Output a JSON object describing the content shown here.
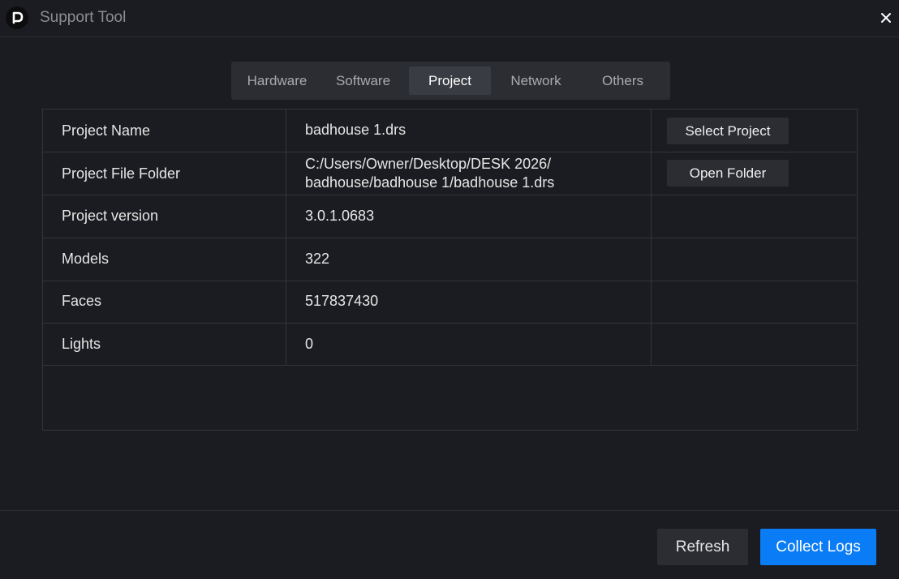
{
  "window": {
    "title": "Support Tool",
    "logo_icon": "app-logo-icon",
    "close_icon": "close-icon"
  },
  "tabs": [
    {
      "label": "Hardware",
      "active": false
    },
    {
      "label": "Software",
      "active": false
    },
    {
      "label": "Project",
      "active": true
    },
    {
      "label": "Network",
      "active": false
    },
    {
      "label": "Others",
      "active": false
    }
  ],
  "project": {
    "rows": [
      {
        "label": "Project Name",
        "value": "badhouse 1.drs",
        "action": "Select Project"
      },
      {
        "label": "Project File Folder",
        "value_line1": "C:/Users/Owner/Desktop/DESK 2026/",
        "value_line2": "badhouse/badhouse 1/badhouse 1.drs",
        "action": "Open Folder"
      },
      {
        "label": "Project version",
        "value": "3.0.1.0683"
      },
      {
        "label": "Models",
        "value": "322"
      },
      {
        "label": "Faces",
        "value": "517837430"
      },
      {
        "label": "Lights",
        "value": "0"
      }
    ]
  },
  "footer": {
    "refresh_label": "Refresh",
    "collect_label": "Collect Logs"
  },
  "colors": {
    "background": "#1b1c21",
    "accent": "#0a7cf5",
    "button": "#2b2d33"
  }
}
